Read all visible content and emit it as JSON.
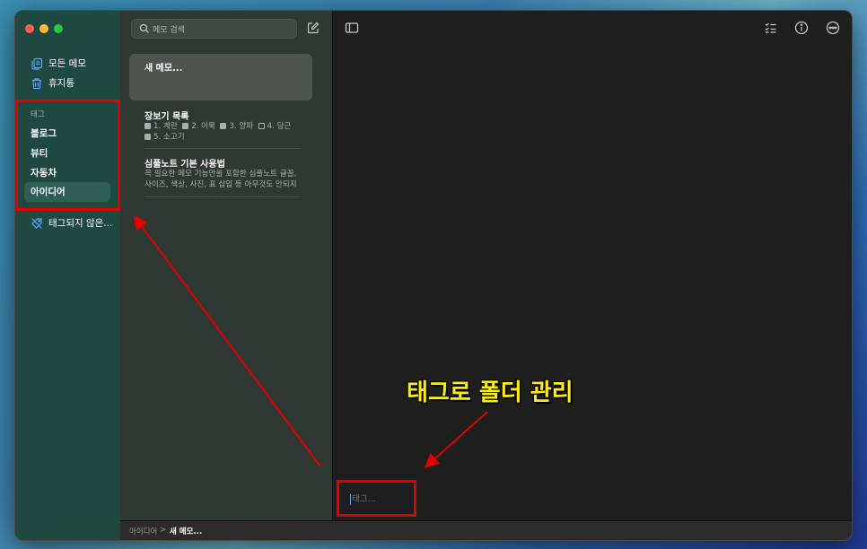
{
  "sidebar": {
    "all_notes": "모든 메모",
    "trash": "휴지통",
    "tag_header": "태그",
    "tags": [
      "블로그",
      "뷰티",
      "자동차",
      "아이디어"
    ],
    "untagged": "태그되지 않은..."
  },
  "list": {
    "search_placeholder": "메모 검색",
    "notes": [
      {
        "title": "새 메모...",
        "preview": ""
      },
      {
        "title": "장보기 목록",
        "items": [
          "1. 계란",
          "2. 어묵",
          "3. 양파",
          "4. 당근",
          "5. 소고기"
        ],
        "checked": [
          true,
          true,
          true,
          false,
          true
        ]
      },
      {
        "title": "심플노트 기본 사용법",
        "preview_line1": "꼭 필요한 메모 기능만을 포함한 심플노트 글꼴,",
        "preview_line2": "사이즈, 색상, 사진, 표 삽입 등 아무것도 안되지"
      }
    ]
  },
  "editor": {
    "tag_placeholder": "태그...",
    "annotation": "태그로 폴더 관리"
  },
  "status": {
    "crumb_parent": "아이디어",
    "crumb_sep": ">",
    "crumb_current": "새 메모..."
  },
  "icons": {
    "all_notes": "notes-icon",
    "trash": "trash-icon",
    "untagged": "tag-slash-icon",
    "search": "search-icon",
    "compose": "compose-icon",
    "sidebar_toggle": "sidebar-toggle-icon",
    "checklist": "checklist-icon",
    "info": "info-icon",
    "more": "more-icon"
  },
  "colors": {
    "accent": "#5aa1ff",
    "annotation": "#ffee14",
    "annotation_box": "#e00000"
  }
}
